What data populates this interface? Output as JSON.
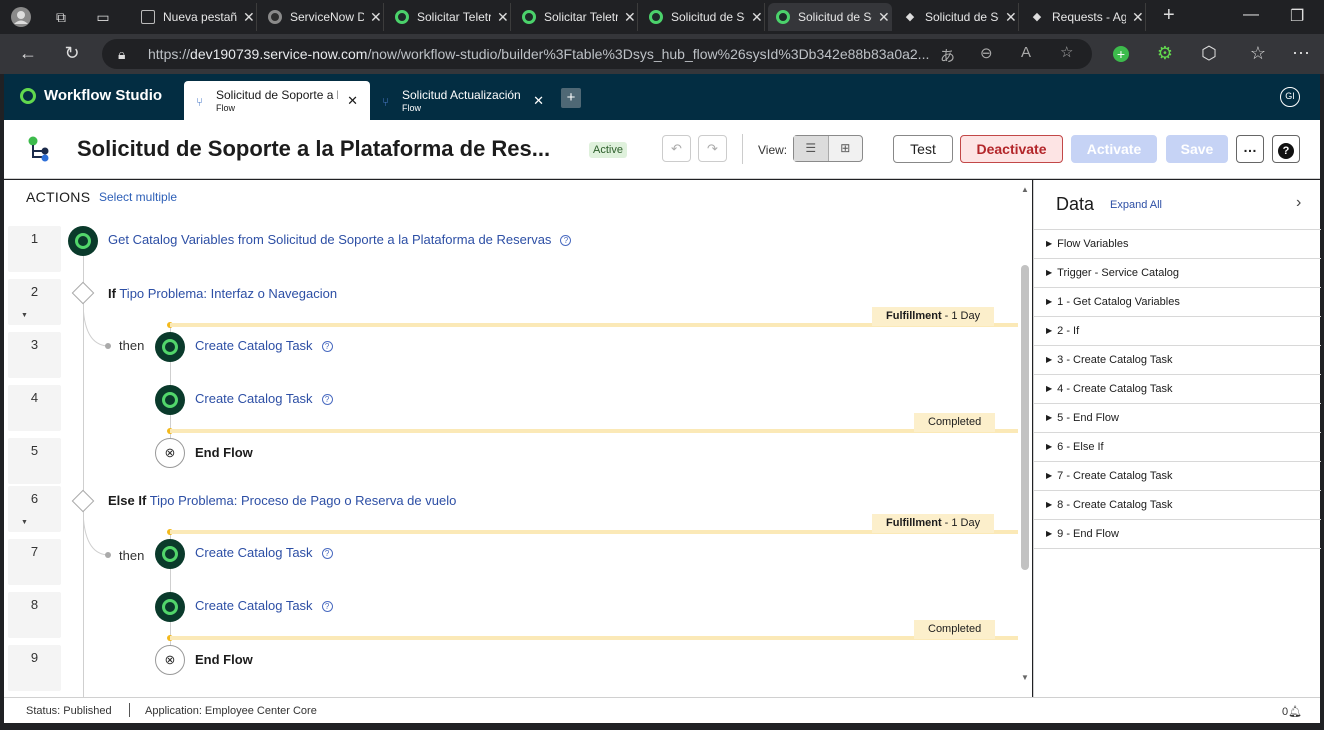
{
  "browser": {
    "tabs": [
      {
        "label": "Nueva pestaña",
        "icon": "document-icon"
      },
      {
        "label": "ServiceNow Developers",
        "icon": "servicenow-icon"
      },
      {
        "label": "Solicitar Teletrabajo",
        "icon": "servicenow-green-icon"
      },
      {
        "label": "Solicitar Teletrabajo",
        "icon": "servicenow-green-icon"
      },
      {
        "label": "Solicitud de Soporte",
        "icon": "servicenow-green-icon"
      },
      {
        "label": "Solicitud de Soporte",
        "icon": "servicenow-green-icon",
        "active": true
      },
      {
        "label": "Solicitud de Soporte",
        "icon": "chat-icon"
      },
      {
        "label": "Requests - Agent",
        "icon": "chat-icon"
      }
    ],
    "url_prefix": "https://",
    "url_host": "dev190739.service-now.com",
    "url_path": "/now/workflow-studio/builder%3Ftable%3Dsys_hub_flow%26sysId%3Db342e88b83a0a2..."
  },
  "app": {
    "name": "Workflow Studio",
    "tabs": [
      {
        "title": "Solicitud de Soporte a la Plataforma de Reservas",
        "type": "Flow"
      },
      {
        "title": "Solicitud Actualización de Datos",
        "type": "Flow"
      }
    ],
    "user_initials": "GI"
  },
  "flow": {
    "title": "Solicitud de Soporte a la Plataforma de Res...",
    "status": "Active",
    "view_label": "View:",
    "buttons": {
      "test": "Test",
      "deactivate": "Deactivate",
      "activate": "Activate",
      "save": "Save",
      "more": "…",
      "help": "?"
    }
  },
  "actions": {
    "heading": "ACTIONS",
    "select_multiple": "Select multiple",
    "rows": [
      "1",
      "2",
      "3",
      "4",
      "5",
      "6",
      "7",
      "8",
      "9"
    ],
    "step1": "Get Catalog Variables from Solicitud de Soporte a la Plataforma de Reservas",
    "if_keyword": "If",
    "if_condition": "Tipo Problema: Interfaz o Navegacion",
    "elseif_keyword": "Else If",
    "elseif_condition": "Tipo Problema: Proceso de Pago o Reserva de vuelo",
    "then": "then",
    "task": "Create Catalog Task",
    "end_flow": "End Flow",
    "stage_fulfillment": "Fulfillment",
    "stage_duration": " - 1 Day",
    "stage_completed": "Completed"
  },
  "data_panel": {
    "title": "Data",
    "expand_all": "Expand All",
    "items": [
      "Flow Variables",
      "Trigger - Service Catalog",
      "1 - Get Catalog Variables",
      "2 - If",
      "3 - Create Catalog Task",
      "4 - Create Catalog Task",
      "5 - End Flow",
      "6 - Else If",
      "7 - Create Catalog Task",
      "8 - Create Catalog Task",
      "9 - End Flow"
    ]
  },
  "status_bar": {
    "status": "Status: Published",
    "application": "Application: Employee Center Core",
    "notifications": "0"
  },
  "colors": {
    "brand": "#032d42",
    "accent_green": "#62d84e",
    "link": "#2d4fa5",
    "danger": "#b3262a"
  }
}
